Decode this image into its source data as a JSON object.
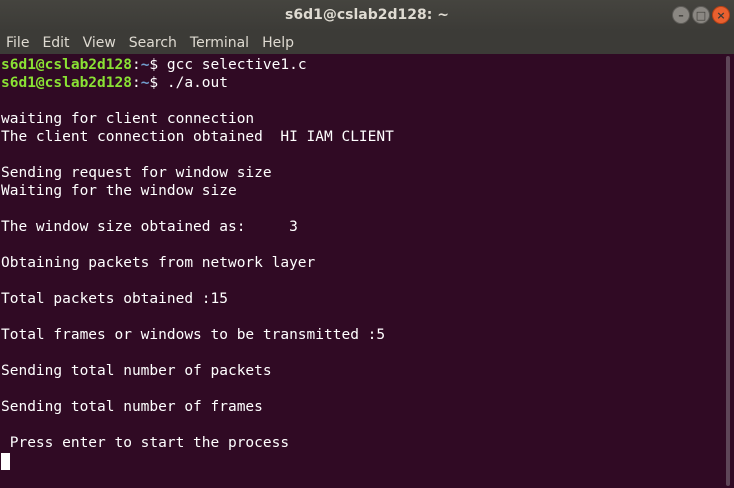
{
  "window": {
    "title": "s6d1@cslab2d128: ~",
    "minimize_icon": "minimize-icon",
    "maximize_icon": "maximize-icon",
    "close_icon": "close-icon"
  },
  "menu": {
    "items": [
      "File",
      "Edit",
      "View",
      "Search",
      "Terminal",
      "Help"
    ]
  },
  "terminal": {
    "prompt_user": "s6d1@cslab2d128",
    "prompt_sep": ":",
    "prompt_path": "~",
    "prompt_symbol": "$ ",
    "commands": [
      "gcc selective1.c",
      "./a.out"
    ],
    "output": [
      "",
      "waiting for client connection",
      "The client connection obtained  HI IAM CLIENT",
      "",
      "Sending request for window size",
      "Waiting for the window size",
      "",
      "The window size obtained as:     3",
      "",
      "Obtaining packets from network layer",
      "",
      "Total packets obtained :15",
      "",
      "Total frames or windows to be transmitted :5",
      "",
      "Sending total number of packets",
      "",
      "Sending total number of frames",
      "",
      " Press enter to start the process"
    ]
  },
  "colors": {
    "background": "#300a24",
    "prompt_user": "#8ae234",
    "prompt_path": "#729fcf",
    "text": "#ffffff"
  }
}
